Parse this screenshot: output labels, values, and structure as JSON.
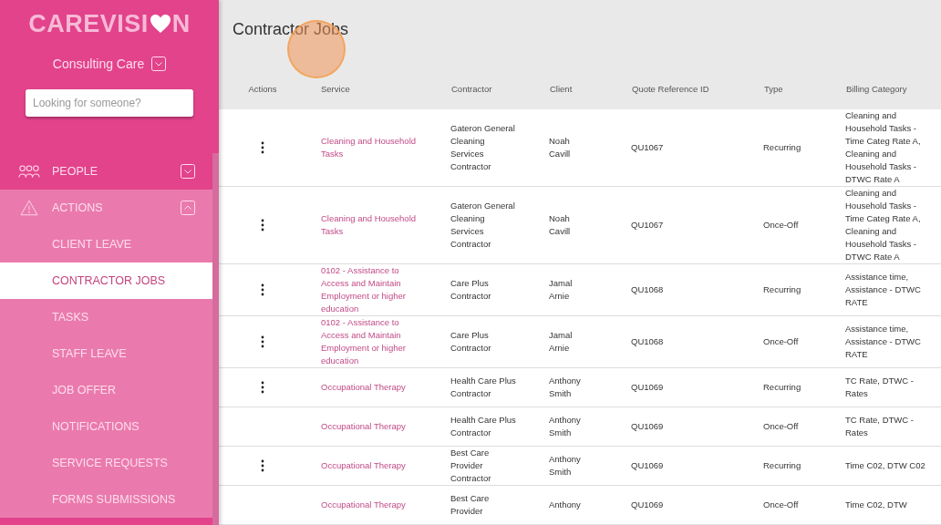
{
  "logo": {
    "before": "CAREVISI",
    "after": "N"
  },
  "organisation": {
    "name": "Consulting Care"
  },
  "search": {
    "placeholder": "Looking for someone?"
  },
  "nav": [
    {
      "label": "PEOPLE",
      "kind": "group",
      "expanded": false,
      "selected": false
    },
    {
      "label": "ACTIONS",
      "kind": "group",
      "expanded": true,
      "selected": false
    },
    {
      "label": "CLIENT LEAVE",
      "kind": "item",
      "selected": false
    },
    {
      "label": "CONTRACTOR JOBS",
      "kind": "item",
      "selected": true
    },
    {
      "label": "TASKS",
      "kind": "item",
      "selected": false
    },
    {
      "label": "STAFF LEAVE",
      "kind": "item",
      "selected": false
    },
    {
      "label": "JOB OFFER",
      "kind": "item",
      "selected": false
    },
    {
      "label": "NOTIFICATIONS",
      "kind": "item",
      "selected": false
    },
    {
      "label": "SERVICE REQUESTS",
      "kind": "item",
      "selected": false
    },
    {
      "label": "FORMS SUBMISSIONS",
      "kind": "item",
      "selected": false
    }
  ],
  "page": {
    "title": "Contractor Jobs"
  },
  "table": {
    "columns": [
      "Actions",
      "Service",
      "Contractor",
      "Client",
      "Quote Reference ID",
      "Type",
      "Billing Category"
    ],
    "rows": [
      {
        "has_menu": true,
        "service": "Cleaning and Household Tasks",
        "contractor": "Gateron General Cleaning Services Contractor",
        "client": "Noah Cavill",
        "quote": "QU1067",
        "type": "Recurring",
        "billing": "Cleaning and Household Tasks - Time Categ Rate A, Cleaning and Household Tasks - DTWC Rate A"
      },
      {
        "has_menu": true,
        "service": "Cleaning and Household Tasks",
        "contractor": "Gateron General Cleaning Services Contractor",
        "client": "Noah Cavill",
        "quote": "QU1067",
        "type": "Once-Off",
        "billing": "Cleaning and Household Tasks - Time Categ Rate A, Cleaning and Household Tasks - DTWC Rate A"
      },
      {
        "has_menu": true,
        "service": "0102 - Assistance to Access and Maintain Employment or higher education",
        "contractor": "Care Plus Contractor",
        "client": "Jamal Arnie",
        "quote": "QU1068",
        "type": "Recurring",
        "billing": "Assistance time, Assistance - DTWC RATE"
      },
      {
        "has_menu": true,
        "service": "0102 - Assistance to Access and Maintain Employment or higher education",
        "contractor": "Care Plus Contractor",
        "client": "Jamal Arnie",
        "quote": "QU1068",
        "type": "Once-Off",
        "billing": "Assistance time, Assistance - DTWC RATE"
      },
      {
        "has_menu": true,
        "service": "Occupational Therapy",
        "contractor": "Health Care Plus Contractor",
        "client": "Anthony Smith",
        "quote": "QU1069",
        "type": "Recurring",
        "billing": "TC Rate, DTWC - Rates"
      },
      {
        "has_menu": false,
        "service": "Occupational Therapy",
        "contractor": "Health Care Plus Contractor",
        "client": "Anthony Smith",
        "quote": "QU1069",
        "type": "Once-Off",
        "billing": "TC Rate, DTWC - Rates"
      },
      {
        "has_menu": true,
        "service": "Occupational Therapy",
        "contractor": "Best Care Provider Contractor",
        "client": "Anthony Smith",
        "quote": "QU1069",
        "type": "Recurring",
        "billing": "Time C02, DTW C02"
      },
      {
        "has_menu": false,
        "service": "Occupational Therapy",
        "contractor": "Best Care Provider",
        "client": "Anthony",
        "quote": "QU1069",
        "type": "Once-Off",
        "billing": "Time C02, DTW"
      }
    ]
  }
}
